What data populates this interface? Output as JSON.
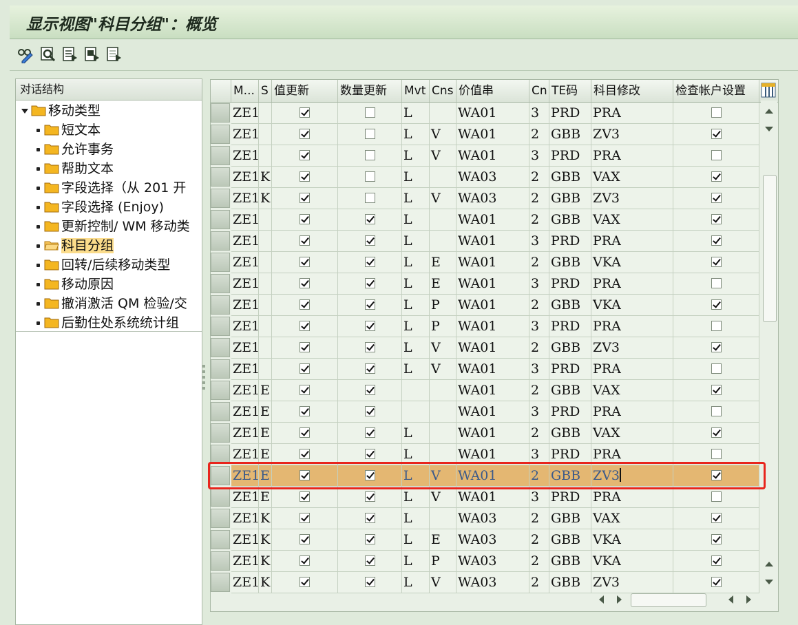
{
  "window": {
    "title": "显示视图\"科目分组\"：概览"
  },
  "toolbar": {
    "buttons": [
      "glasses-pencil-icon",
      "find-icon",
      "select-all-icon",
      "select-block-icon",
      "deselect-icon"
    ]
  },
  "nav": {
    "header": "对话结构",
    "root": "移动类型",
    "items": [
      "短文本",
      "允许事务",
      "帮助文本",
      "字段选择（从 201 开",
      "字段选择 (Enjoy)",
      "更新控制/ WM 移动类",
      "科目分组",
      "回转/后续移动类型",
      "移动原因",
      "撤消激活 QM 检验/交",
      "后勤住处系统统计组"
    ],
    "selected_index": 6
  },
  "grid": {
    "columns": [
      "M...",
      "S",
      "值更新",
      "数量更新",
      "Mvt",
      "Cns",
      "价值串",
      "Cn",
      "TE码",
      "科目修改",
      "检查帐户设置"
    ],
    "highlight_row": 17,
    "rows": [
      [
        "ZE1",
        "",
        true,
        false,
        "L",
        "",
        "WA01",
        "3",
        "PRD",
        "PRA",
        false
      ],
      [
        "ZE1",
        "",
        true,
        false,
        "L",
        "V",
        "WA01",
        "2",
        "GBB",
        "ZV3",
        true
      ],
      [
        "ZE1",
        "",
        true,
        false,
        "L",
        "V",
        "WA01",
        "3",
        "PRD",
        "PRA",
        false
      ],
      [
        "ZE1",
        "K",
        true,
        false,
        "L",
        "",
        "WA03",
        "2",
        "GBB",
        "VAX",
        true
      ],
      [
        "ZE1",
        "K",
        true,
        false,
        "L",
        "V",
        "WA03",
        "2",
        "GBB",
        "ZV3",
        true
      ],
      [
        "ZE1",
        "",
        true,
        true,
        "L",
        "",
        "WA01",
        "2",
        "GBB",
        "VAX",
        true
      ],
      [
        "ZE1",
        "",
        true,
        true,
        "L",
        "",
        "WA01",
        "3",
        "PRD",
        "PRA",
        true
      ],
      [
        "ZE1",
        "",
        true,
        true,
        "L",
        "E",
        "WA01",
        "2",
        "GBB",
        "VKA",
        true
      ],
      [
        "ZE1",
        "",
        true,
        true,
        "L",
        "E",
        "WA01",
        "3",
        "PRD",
        "PRA",
        false
      ],
      [
        "ZE1",
        "",
        true,
        true,
        "L",
        "P",
        "WA01",
        "2",
        "GBB",
        "VKA",
        true
      ],
      [
        "ZE1",
        "",
        true,
        true,
        "L",
        "P",
        "WA01",
        "3",
        "PRD",
        "PRA",
        false
      ],
      [
        "ZE1",
        "",
        true,
        true,
        "L",
        "V",
        "WA01",
        "2",
        "GBB",
        "ZV3",
        true
      ],
      [
        "ZE1",
        "",
        true,
        true,
        "L",
        "V",
        "WA01",
        "3",
        "PRD",
        "PRA",
        false
      ],
      [
        "ZE1",
        "E",
        true,
        true,
        "",
        "",
        "WA01",
        "2",
        "GBB",
        "VAX",
        true
      ],
      [
        "ZE1",
        "E",
        true,
        true,
        "",
        "",
        "WA01",
        "3",
        "PRD",
        "PRA",
        false
      ],
      [
        "ZE1",
        "E",
        true,
        true,
        "L",
        "",
        "WA01",
        "2",
        "GBB",
        "VAX",
        true
      ],
      [
        "ZE1",
        "E",
        true,
        true,
        "L",
        "",
        "WA01",
        "3",
        "PRD",
        "PRA",
        false
      ],
      [
        "ZE1",
        "E",
        true,
        true,
        "L",
        "V",
        "WA01",
        "2",
        "GBB",
        "ZV3",
        true
      ],
      [
        "ZE1",
        "E",
        true,
        true,
        "L",
        "V",
        "WA01",
        "3",
        "PRD",
        "PRA",
        false
      ],
      [
        "ZE1",
        "K",
        true,
        true,
        "L",
        "",
        "WA03",
        "2",
        "GBB",
        "VAX",
        true
      ],
      [
        "ZE1",
        "K",
        true,
        true,
        "L",
        "E",
        "WA03",
        "2",
        "GBB",
        "VKA",
        true
      ],
      [
        "ZE1",
        "K",
        true,
        true,
        "L",
        "P",
        "WA03",
        "2",
        "GBB",
        "VKA",
        true
      ],
      [
        "ZE1",
        "K",
        true,
        true,
        "L",
        "V",
        "WA03",
        "2",
        "GBB",
        "ZV3",
        true
      ]
    ]
  },
  "colors": {
    "highlight": "#e4b772",
    "selected_nav": "#fbdc8b",
    "callout": "#e8251d"
  }
}
